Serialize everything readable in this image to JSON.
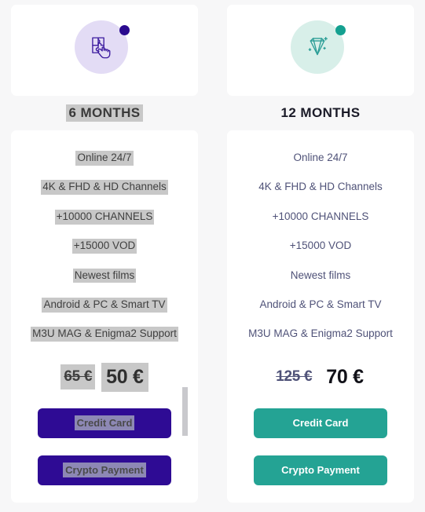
{
  "page": {
    "background_color": "#f7f7f8",
    "card_background": "#ffffff",
    "selection_highlight_color": "#c8c8c8"
  },
  "plans": [
    {
      "id": "plan-6-months",
      "title": "6 MONTHS",
      "icon_name": "puzzle-hand-icon",
      "icon_circle_color": "#e3dcf5",
      "icon_dot_color": "#2a0a8f",
      "accent_color": "#2e0b94",
      "selected": true,
      "features": [
        "Online 24/7",
        "4K & FHD & HD Channels",
        "+10000 CHANNELS",
        "+15000 VOD",
        "Newest films",
        "Android & PC & Smart TV",
        "M3U MAG & Enigma2 Support"
      ],
      "price": {
        "old": "65 €",
        "new": "50 €"
      },
      "buttons": [
        {
          "label": "Credit Card",
          "name": "credit-card-button"
        },
        {
          "label": "Crypto Payment",
          "name": "crypto-payment-button"
        }
      ]
    },
    {
      "id": "plan-12-months",
      "title": "12 MONTHS",
      "icon_name": "diamond-icon",
      "icon_circle_color": "#d8efe9",
      "icon_dot_color": "#14a090",
      "accent_color": "#24a394",
      "selected": false,
      "features": [
        "Online 24/7",
        "4K & FHD & HD Channels",
        "+10000 CHANNELS",
        "+15000 VOD",
        "Newest films",
        "Android & PC & Smart TV",
        "M3U MAG & Enigma2 Support"
      ],
      "price": {
        "old": "125 €",
        "new": "70 €"
      },
      "buttons": [
        {
          "label": "Credit Card",
          "name": "credit-card-button"
        },
        {
          "label": "Crypto Payment",
          "name": "crypto-payment-button"
        }
      ]
    }
  ]
}
